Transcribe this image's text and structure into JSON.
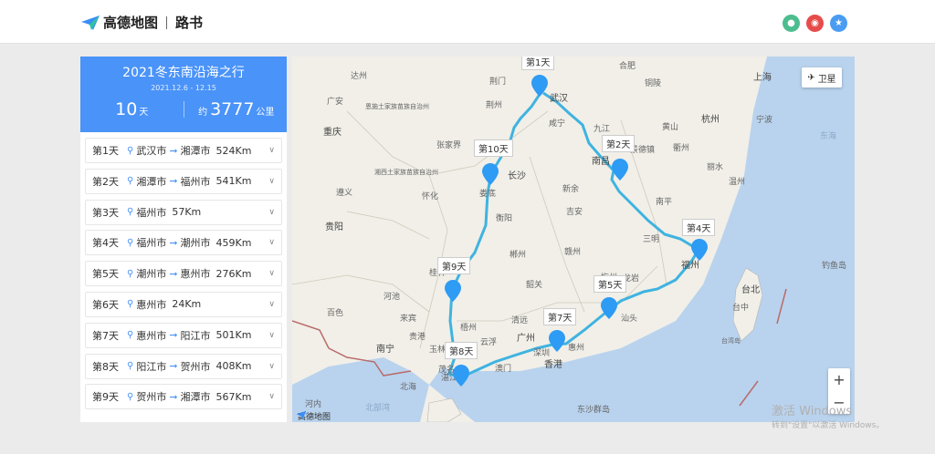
{
  "header": {
    "brand": "高德地图",
    "product": "路书",
    "share": [
      {
        "name": "wechat-share-icon",
        "color": "#4cbd8f"
      },
      {
        "name": "weibo-share-icon",
        "color": "#e64c4b"
      },
      {
        "name": "qq-share-icon",
        "color": "#4a9cf2"
      }
    ]
  },
  "trip": {
    "title": "2021冬东南沿海之行",
    "dates": "2021.12.6 - 12.15",
    "days_value": "10",
    "days_unit": "天",
    "dist_prefix": "约",
    "dist_value": "3777",
    "dist_unit": "公里"
  },
  "days": [
    {
      "label": "第1天",
      "from": "武汉市",
      "to": "湘潭市",
      "dist": "524Km"
    },
    {
      "label": "第2天",
      "from": "湘潭市",
      "to": "福州市",
      "dist": "541Km"
    },
    {
      "label": "第3天",
      "from": "福州市",
      "to": "",
      "dist": "57Km"
    },
    {
      "label": "第4天",
      "from": "福州市",
      "to": "潮州市",
      "dist": "459Km"
    },
    {
      "label": "第5天",
      "from": "潮州市",
      "to": "惠州市",
      "dist": "276Km"
    },
    {
      "label": "第6天",
      "from": "惠州市",
      "to": "",
      "dist": "24Km"
    },
    {
      "label": "第7天",
      "from": "惠州市",
      "to": "阳江市",
      "dist": "501Km"
    },
    {
      "label": "第8天",
      "from": "阳江市",
      "to": "贺州市",
      "dist": "408Km"
    },
    {
      "label": "第9天",
      "from": "贺州市",
      "to": "湘潭市",
      "dist": "567Km"
    }
  ],
  "map": {
    "satellite_label": "卫星",
    "zoom_in": "+",
    "zoom_out": "−",
    "logo_text": "高德地图",
    "markers": [
      "第1天",
      "第2天",
      "第4天",
      "第5天",
      "第7天",
      "第8天",
      "第9天",
      "第10天"
    ],
    "places": [
      "达州",
      "荆门",
      "合肥",
      "上海",
      "广安",
      "恩施土家族苗族自治州",
      "荆州",
      "铜陵",
      "杭州",
      "宁波",
      "重庆",
      "武汉",
      "咸宁",
      "黄山",
      "衢州",
      "东海",
      "张家界",
      "九江",
      "景德镇",
      "丽水",
      "湘西土家族苗族自治州",
      "长沙",
      "南昌",
      "温州",
      "遵义",
      "怀化",
      "娄底",
      "新余",
      "南平",
      "贵阳",
      "衡阳",
      "吉安",
      "赣州",
      "三明",
      "福州",
      "钓鱼岛",
      "桂林",
      "郴州",
      "梅州",
      "龙岩",
      "河池",
      "韶关",
      "台北",
      "百色",
      "来宾",
      "清远",
      "汕头",
      "台中",
      "贵港",
      "梧州",
      "南宁",
      "云浮",
      "广州",
      "惠州",
      "玉林",
      "深圳",
      "香港",
      "台湾岛",
      "北海",
      "澳门",
      "茂名",
      "湛江",
      "河内",
      "北部湾",
      "东沙群岛"
    ],
    "route_color": "#3fb3e0"
  },
  "watermark": {
    "line1": "激活 Windows",
    "line2": "转到\"设置\"以激活 Windows。"
  }
}
